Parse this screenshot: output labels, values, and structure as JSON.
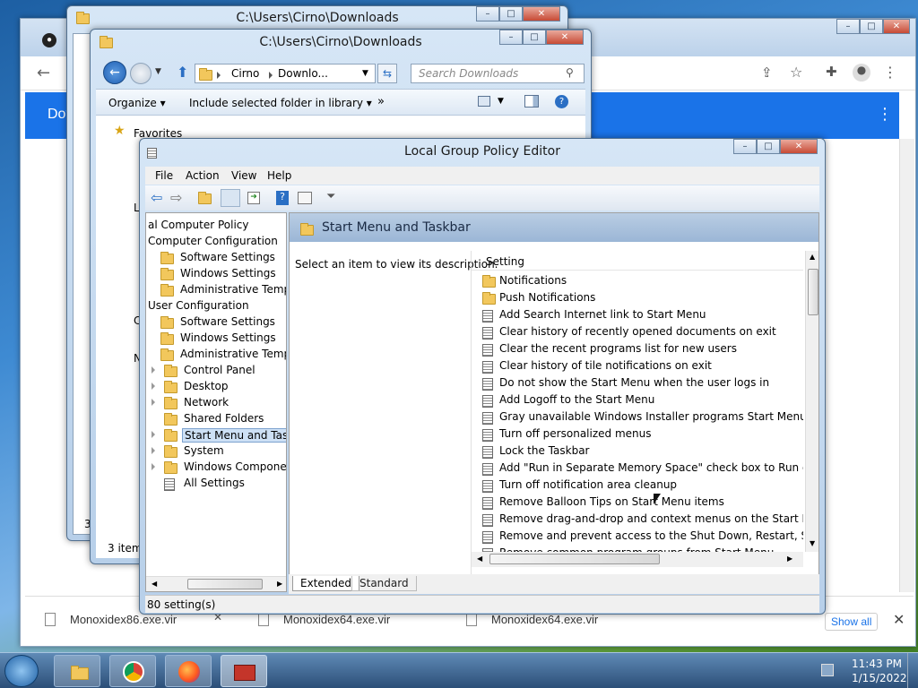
{
  "explorer_back": {
    "title": "C:\\Users\\Cirno\\Downloads"
  },
  "explorer": {
    "title": "C:\\Users\\Cirno\\Downloads",
    "breadcrumb": [
      "Cirno",
      "Downlo..."
    ],
    "search_placeholder": "Search Downloads",
    "toolbar": {
      "organize": "Organize",
      "include": "Include selected folder in library",
      "more": "»"
    },
    "nav": {
      "favorites": "Favorites",
      "l_cut": "L",
      "c_cut": "C",
      "n_cut": "N"
    },
    "status": "3 item",
    "status_back": "3"
  },
  "chrome": {
    "header_text": "Dov",
    "downloads": [
      "Monoxidex86.exe.vir",
      "Monoxidex64.exe.vir",
      "Monoxidex64.exe.vir"
    ],
    "show_all": "Show all"
  },
  "gpe": {
    "title": "Local Group Policy Editor",
    "menu": [
      "File",
      "Action",
      "View",
      "Help"
    ],
    "tree": [
      {
        "label": "al Computer Policy",
        "indent": 0,
        "type": "root"
      },
      {
        "label": "Computer Configuration",
        "indent": 0,
        "type": "root"
      },
      {
        "label": "Software Settings",
        "indent": 1,
        "type": "folder"
      },
      {
        "label": "Windows Settings",
        "indent": 1,
        "type": "folder"
      },
      {
        "label": "Administrative Templates",
        "indent": 1,
        "type": "folder"
      },
      {
        "label": "User Configuration",
        "indent": 0,
        "type": "root"
      },
      {
        "label": "Software Settings",
        "indent": 1,
        "type": "folder"
      },
      {
        "label": "Windows Settings",
        "indent": 1,
        "type": "folder"
      },
      {
        "label": "Administrative Templates",
        "indent": 1,
        "type": "folder"
      },
      {
        "label": "Control Panel",
        "indent": 2,
        "type": "folder",
        "arrow": true
      },
      {
        "label": "Desktop",
        "indent": 2,
        "type": "folder",
        "arrow": true
      },
      {
        "label": "Network",
        "indent": 2,
        "type": "folder",
        "arrow": true
      },
      {
        "label": "Shared Folders",
        "indent": 2,
        "type": "folder"
      },
      {
        "label": "Start Menu and Taskb",
        "indent": 2,
        "type": "folder",
        "arrow": true,
        "selected": true
      },
      {
        "label": "System",
        "indent": 2,
        "type": "folder",
        "arrow": true
      },
      {
        "label": "Windows Component",
        "indent": 2,
        "type": "folder",
        "arrow": true
      },
      {
        "label": "All Settings",
        "indent": 2,
        "type": "settings"
      }
    ],
    "header": "Start Menu and Taskbar",
    "description": "Select an item to view its description.",
    "column": "Setting",
    "settings": [
      {
        "label": "Notifications",
        "type": "folder"
      },
      {
        "label": "Push Notifications",
        "type": "folder"
      },
      {
        "label": "Add Search Internet link to Start Menu",
        "type": "setting"
      },
      {
        "label": "Clear history of recently opened documents on exit",
        "type": "setting"
      },
      {
        "label": "Clear the recent programs list for new users",
        "type": "setting"
      },
      {
        "label": "Clear history of tile notifications on exit",
        "type": "setting"
      },
      {
        "label": "Do not show the Start Menu when the user logs in",
        "type": "setting"
      },
      {
        "label": "Add Logoff to the Start Menu",
        "type": "setting"
      },
      {
        "label": "Gray unavailable Windows Installer programs Start Menu sh...",
        "type": "setting"
      },
      {
        "label": "Turn off personalized menus",
        "type": "setting"
      },
      {
        "label": "Lock the Taskbar",
        "type": "setting"
      },
      {
        "label": "Add \"Run in Separate Memory Space\" check box to Run dial...",
        "type": "setting"
      },
      {
        "label": "Turn off notification area cleanup",
        "type": "setting"
      },
      {
        "label": "Remove Balloon Tips on Start Menu items",
        "type": "setting"
      },
      {
        "label": "Remove drag-and-drop and context menus on the Start Me...",
        "type": "setting"
      },
      {
        "label": "Remove and prevent access to the Shut Down, Restart, Sleep...",
        "type": "setting"
      },
      {
        "label": "Remove common program groups from Start Menu",
        "type": "setting"
      }
    ],
    "tabs": [
      "Extended",
      "Standard"
    ],
    "status": "80 setting(s)"
  },
  "taskbar": {
    "time": "11:43 PM",
    "date": "1/15/2022"
  }
}
